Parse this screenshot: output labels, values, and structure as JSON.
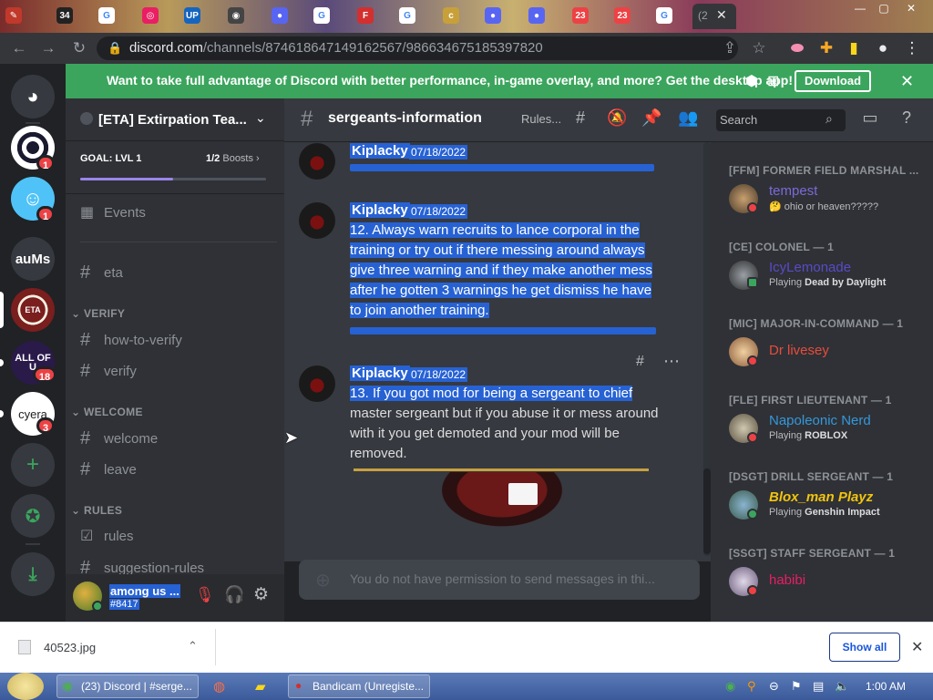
{
  "browser": {
    "url_host": "discord.com",
    "url_path": "/channels/874618647149162567/986634675185397820",
    "tab_badges": [
      "34",
      "23",
      "23"
    ],
    "active_tab_label": "(2"
  },
  "banner": {
    "text": "Want to take full advantage of Discord with better performance, in-game overlay, and more? Get the desktop app!",
    "download_label": "Download"
  },
  "guilds": {
    "items": [
      {
        "label": "",
        "badge": "1"
      },
      {
        "label": "",
        "badge": "1"
      },
      {
        "label": "auMs",
        "badge": ""
      },
      {
        "label": "ETA",
        "badge": ""
      },
      {
        "label": "ALL OF U",
        "badge": "18"
      },
      {
        "label": "cyera",
        "badge": "3"
      }
    ]
  },
  "server": {
    "name": "[ETA] Extirpation Tea...",
    "goal_label": "GOAL: LVL 1",
    "boosts_count": "1/2",
    "boosts_label": "Boosts",
    "boost_progress": 0.5
  },
  "channels": {
    "events_label": "Events",
    "eta": "eta",
    "cat_verify": "VERIFY",
    "how_to_verify": "how-to-verify",
    "verify": "verify",
    "cat_welcome": "WELCOME",
    "welcome": "welcome",
    "leave": "leave",
    "cat_rules": "RULES",
    "rules": "rules",
    "suggestion_rules": "suggestion-rules"
  },
  "user": {
    "name": "among us ...",
    "tag": "#8417"
  },
  "header": {
    "channel_name": "sergeants-information",
    "topic": "Rules...",
    "search_placeholder": "Search"
  },
  "messages": [
    {
      "author": "Kiplacky",
      "date": "07/18/2022",
      "body": ""
    },
    {
      "author": "Kiplacky",
      "date": "07/18/2022",
      "body": "12. Always warn recruits to lance corporal in the training or try out if there messing around always give three warning and if they make another mess after he gotten 3 warnings he get dismiss he have to join another training."
    },
    {
      "author": "Kiplacky",
      "date": "07/18/2022",
      "body_selected": "13. If you got mod for being a sergeant to chief",
      "body_rest": "master sergeant but if you abuse it or mess around  with it you get demoted and your mod will be removed."
    }
  ],
  "composer": {
    "placeholder": "You do not have permission to send messages in thi..."
  },
  "members": [
    {
      "role": "[FFM] FORMER FIELD MARSHAL ...",
      "name": "tempest",
      "name_color": "#7a6ad8",
      "status_prefix": "",
      "status_value": "ohio or heaven?????",
      "status_icon": "🤔",
      "dot": "#ed4245"
    },
    {
      "role": "[CE] COLONEL — 1",
      "name": "IcyLemonade",
      "name_color": "#5a4ac8",
      "status_prefix": "Playing",
      "status_value": "Dead by Daylight",
      "status_icon": "",
      "dot": "#3ba55d"
    },
    {
      "role": "[MIC] MAJOR-IN-COMMAND — 1",
      "name": "Dr livesey",
      "name_color": "#e74c3c",
      "status_prefix": "",
      "status_value": "",
      "status_icon": "",
      "dot": "#ed4245"
    },
    {
      "role": "[FLE] FIRST LIEUTENANT — 1",
      "name": "Napoleonic Nerd",
      "name_color": "#3498db",
      "status_prefix": "Playing",
      "status_value": "ROBLOX",
      "status_icon": "",
      "dot": "#ed4245"
    },
    {
      "role": "[DSGT] DRILL SERGEANT — 1",
      "name": "Blox_man Playz",
      "name_color": "#f1c40f",
      "status_prefix": "Playing",
      "status_value": "Genshin Impact",
      "status_icon": "",
      "dot": "#3ba55d"
    },
    {
      "role": "[SSGT] STAFF SERGEANT — 1",
      "name": "habibi",
      "name_color": "#e91e63",
      "status_prefix": "",
      "status_value": "",
      "status_icon": "",
      "dot": "#ed4245"
    }
  ],
  "download_shelf": {
    "file_name": "40523.jpg",
    "show_all_label": "Show all"
  },
  "taskbar": {
    "items": [
      "(23) Discord | #serge...",
      "Bandicam (Unregiste..."
    ],
    "clock": "1:00 AM"
  }
}
